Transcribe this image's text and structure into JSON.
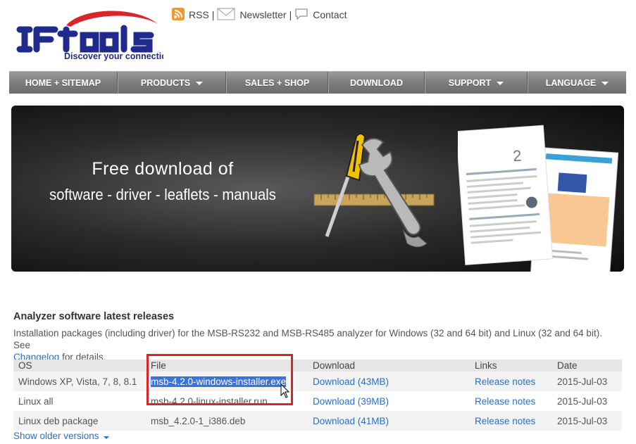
{
  "header": {
    "logo_text": "IF tools",
    "logo_tagline": "Discover your connection",
    "links": [
      {
        "label": "RSS",
        "icon": "rss-icon"
      },
      {
        "label": "Newsletter",
        "icon": "envelope-icon"
      },
      {
        "label": "Contact",
        "icon": "speech-bubble-icon"
      }
    ],
    "separator": "|"
  },
  "nav": {
    "items": [
      {
        "label": "HOME + SITEMAP",
        "dropdown": false
      },
      {
        "label": "PRODUCTS",
        "dropdown": true
      },
      {
        "label": "SALES + SHOP",
        "dropdown": false
      },
      {
        "label": "DOWNLOAD",
        "dropdown": false
      },
      {
        "label": "SUPPORT",
        "dropdown": true
      },
      {
        "label": "LANGUAGE",
        "dropdown": true
      }
    ]
  },
  "banner": {
    "title": "Free download of",
    "subtitle": "software - driver - leaflets - manuals",
    "doc_number": "2"
  },
  "section": {
    "title": "Analyzer software latest releases",
    "intro": "Installation packages (including driver) for the MSB-RS232 and MSB-RS485 analyzer for Windows (32 and 64 bit) and Linux (32 and 64 bit). See",
    "changelog_link": "Changelog",
    "intro_tail": "for details."
  },
  "table": {
    "headers": [
      "OS",
      "File",
      "Download",
      "Links",
      "Date"
    ],
    "rows": [
      {
        "os": "Windows XP, Vista, 7, 8, 8.1",
        "file": "msb-4.2.0-windows-installer.exe",
        "download": "Download (43MB)",
        "links": "Release notes",
        "date": "2015-Jul-03"
      },
      {
        "os": "Linux all",
        "file": "msb-4.2.0-linux-installer.run",
        "download": "Download (39MB)",
        "links": "Release notes",
        "date": "2015-Jul-03"
      },
      {
        "os": "Linux deb package",
        "file": "msb_4.2.0-1_i386.deb",
        "download": "Download (41MB)",
        "links": "Release notes",
        "date": "2015-Jul-03"
      }
    ]
  },
  "show_older": "Show older versions",
  "colors": {
    "link": "#2a6fc9",
    "nav_bg": "#7d7d7d",
    "highlight_box": "#d9242a",
    "selection": "#3a74d8",
    "logo_blue": "#1f2a8c",
    "logo_red": "#d9242a"
  }
}
